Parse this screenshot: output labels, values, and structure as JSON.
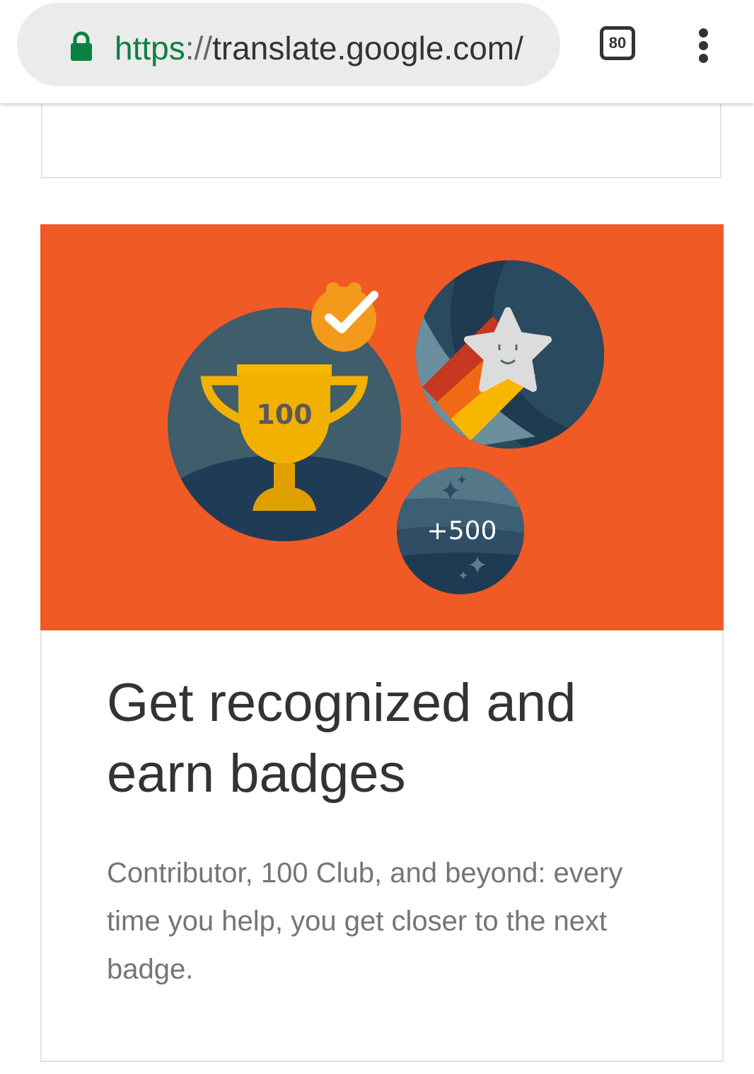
{
  "browser": {
    "url_scheme": "https",
    "url_separator": "://",
    "url_host": "translate.google.com/",
    "tab_count": "80",
    "lock_color": "#0b8043"
  },
  "card": {
    "banner_color": "#f05a24",
    "badges": {
      "trophy_label": "100",
      "points_label": "+500"
    },
    "title": "Get recognized and earn badges",
    "body": "Contributor, 100 Club, and beyond: every time you help, you get closer to the next badge."
  }
}
